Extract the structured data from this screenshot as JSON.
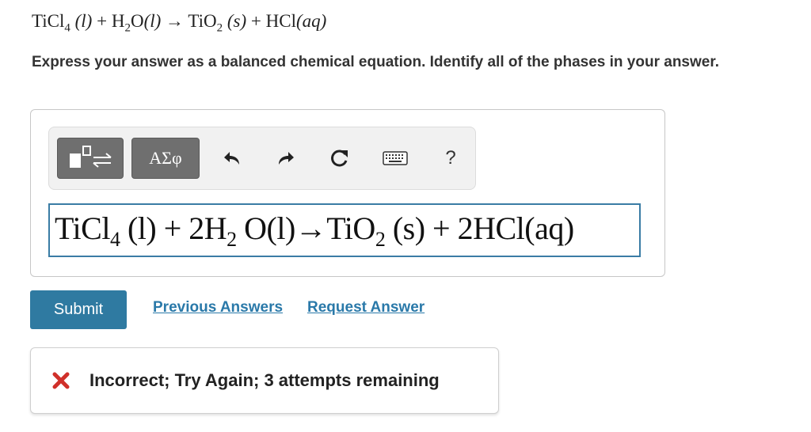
{
  "question": {
    "reactant1": "TiCl",
    "reactant1_sub": "4",
    "reactant1_phase": "(l)",
    "plus1": "+",
    "reactant2_a": "H",
    "reactant2_sub": "2",
    "reactant2_b": "O",
    "reactant2_phase": "(l)",
    "arrow": "→",
    "product1": "TiO",
    "product1_sub": "2",
    "product1_phase": "(s)",
    "plus2": "+",
    "product2": "HCl",
    "product2_phase": "(aq)"
  },
  "instructions": "Express your answer as a balanced chemical equation. Identify all of the phases in your answer.",
  "toolbar": {
    "symbols_label": "ΑΣφ",
    "help_label": "?",
    "icons": [
      "templates-icon",
      "undo-icon",
      "redo-icon",
      "reset-icon",
      "keyboard-icon"
    ]
  },
  "answer": {
    "p1": "TiCl",
    "p1_sub": "4",
    "p2": " (l) + 2H",
    "p2_sub": "2",
    "p3": " O(l)→TiO",
    "p3_sub": "2",
    "p4": " (s) + 2HCl(aq)"
  },
  "actions": {
    "submit_label": "Submit",
    "previous_answers_label": "Previous Answers",
    "request_answer_label": "Request Answer"
  },
  "feedback": {
    "message": "Incorrect; Try Again; 3 attempts remaining",
    "status_color": "#d0302a"
  },
  "colors": {
    "accent": "#2f7aa1",
    "link": "#2a79a9",
    "field_border": "#3a7ca5"
  }
}
